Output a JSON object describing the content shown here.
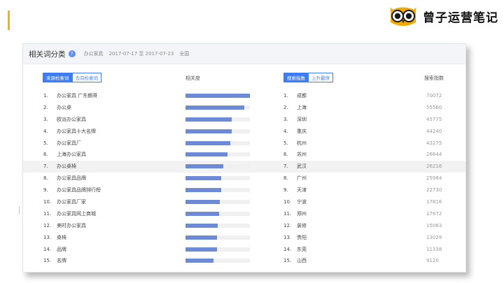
{
  "brand": {
    "name": "曾子运营笔记",
    "logo_icon": "owl-icon"
  },
  "panel": {
    "title": "相关词分类",
    "keyword": "办公家具",
    "date_range": "2017-07-17 至 2017-07-23",
    "region": "全国"
  },
  "left_tabs": [
    {
      "label": "来源检索词",
      "active": true
    },
    {
      "label": "去向检索词",
      "active": false
    }
  ],
  "right_tabs": [
    {
      "label": "搜索指数",
      "active": true
    },
    {
      "label": "上升最快",
      "active": false
    }
  ],
  "columns": {
    "relevance": "相关度",
    "search_index": "搜索指数"
  },
  "colors": {
    "accent": "#3d7cf5",
    "bar": "#6c8ad5",
    "slide_accent": "#f2b400"
  },
  "related_words": [
    {
      "rank": "1.",
      "word": "办公家具 广东朗哥",
      "relevance": 1.0
    },
    {
      "rank": "2.",
      "word": "办公桌",
      "relevance": 0.91
    },
    {
      "rank": "3.",
      "word": "欧派办公家具",
      "relevance": 0.72
    },
    {
      "rank": "4.",
      "word": "办公家具十大名牌",
      "relevance": 0.72
    },
    {
      "rank": "5.",
      "word": "办公家具厂",
      "relevance": 0.69
    },
    {
      "rank": "6.",
      "word": "上海办公家具",
      "relevance": 0.65
    },
    {
      "rank": "7.",
      "word": "办公桌椅",
      "relevance": 0.59
    },
    {
      "rank": "8.",
      "word": "办公家具品牌",
      "relevance": 0.55
    },
    {
      "rank": "9.",
      "word": "办公家具品牌排行榜",
      "relevance": 0.55
    },
    {
      "rank": "10.",
      "word": "办公家具厂家",
      "relevance": 0.53
    },
    {
      "rank": "11.",
      "word": "办公家具网上商城",
      "relevance": 0.52
    },
    {
      "rank": "12.",
      "word": "美时办公家具",
      "relevance": 0.5
    },
    {
      "rank": "13.",
      "word": "桌椅",
      "relevance": 0.49
    },
    {
      "rank": "14.",
      "word": "品牌",
      "relevance": 0.49
    },
    {
      "rank": "15.",
      "word": "名牌",
      "relevance": 0.43
    }
  ],
  "highlighted_row": 6,
  "cities": [
    {
      "rank": "1.",
      "city": "成都",
      "index": "70072"
    },
    {
      "rank": "2.",
      "city": "上海",
      "index": "55560"
    },
    {
      "rank": "3.",
      "city": "深圳",
      "index": "45775"
    },
    {
      "rank": "4.",
      "city": "重庆",
      "index": "44240"
    },
    {
      "rank": "5.",
      "city": "杭州",
      "index": "43275"
    },
    {
      "rank": "6.",
      "city": "苏州",
      "index": "26644"
    },
    {
      "rank": "7.",
      "city": "武汉",
      "index": "26216"
    },
    {
      "rank": "8.",
      "city": "广州",
      "index": "25984"
    },
    {
      "rank": "9.",
      "city": "天津",
      "index": "22730"
    },
    {
      "rank": "10.",
      "city": "宁波",
      "index": "17816"
    },
    {
      "rank": "11.",
      "city": "郑州",
      "index": "17672"
    },
    {
      "rank": "12.",
      "city": "装修",
      "index": "15063"
    },
    {
      "rank": "13.",
      "city": "贵阳",
      "index": "13029"
    },
    {
      "rank": "14.",
      "city": "东莞",
      "index": "11338"
    },
    {
      "rank": "15.",
      "city": "山西",
      "index": "9120"
    }
  ]
}
